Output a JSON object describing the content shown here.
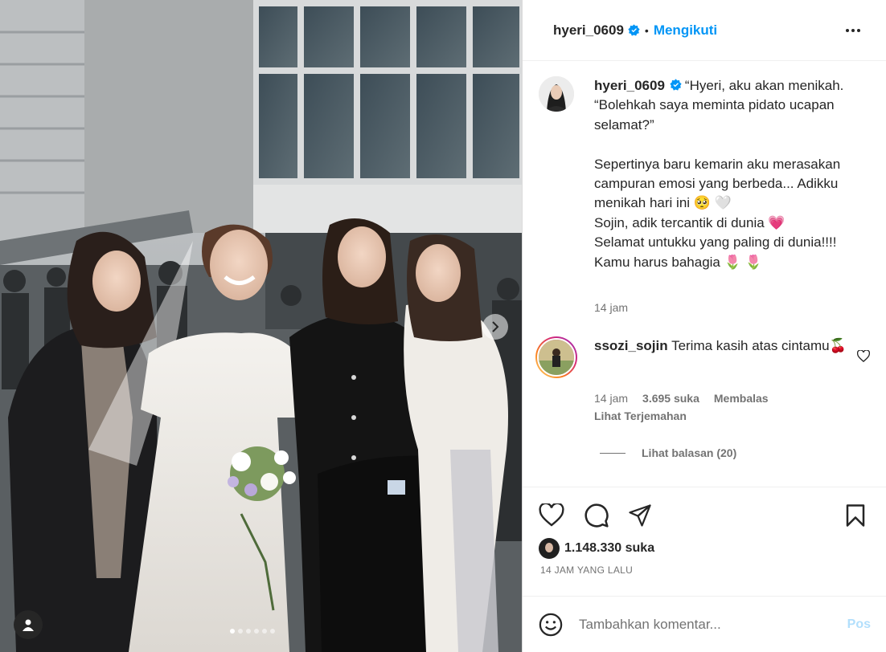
{
  "post": {
    "username": "hyeri_0609",
    "follow_label": "Mengikuti",
    "separator": "•"
  },
  "caption": {
    "username": "hyeri_0609",
    "text": "“Hyeri, aku akan menikah. “Bolehkah saya meminta pidato ucapan selamat?”\n\nSepertinya baru kemarin aku merasakan campuran emosi yang berbeda... Adikku menikah hari ini 🥺 🤍\nSojin, adik tercantik di dunia 💗\nSelamat untukku yang paling di dunia!!!! Kamu harus bahagia 🌷 🌷",
    "time": "14 jam"
  },
  "reply": {
    "username": "ssozi_sojin",
    "text": "Terima kasih atas cintamu🍒",
    "time": "14 jam",
    "likes": "3.695 suka",
    "reply_label": "Membalas",
    "translate_label": "Lihat Terjemahan",
    "view_replies": "Lihat balasan (20)"
  },
  "stats": {
    "likes": "1.148.330 suka",
    "time_ago": "14 JAM YANG LALU"
  },
  "comment_box": {
    "placeholder": "Tambahkan komentar...",
    "post_label": "Pos"
  },
  "carousel": {
    "total": 6,
    "active_index": 0
  },
  "colors": {
    "accent": "#0095f6",
    "verified": "#0095f6",
    "post_disabled": "#b2dffc"
  }
}
